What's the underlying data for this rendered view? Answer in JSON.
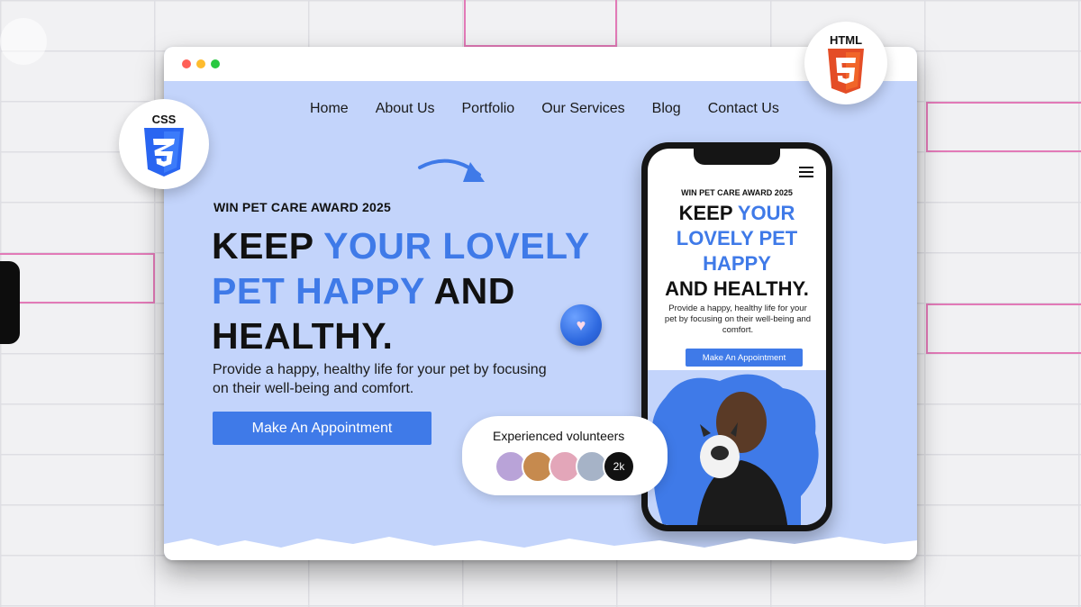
{
  "nav": [
    "Home",
    "About Us",
    "Portfolio",
    "Our Services",
    "Blog",
    "Contact Us"
  ],
  "hero": {
    "award": "WIN PET CARE AWARD 2025",
    "headline_1": "KEEP ",
    "headline_blue": "YOUR LOVELY PET HAPPY",
    "headline_2": " AND HEALTHY.",
    "subtext": "Provide a happy, healthy life for your pet by focusing on their well-being and comfort.",
    "cta": "Make An Appointment"
  },
  "volunteers": {
    "title": "Experienced volunteers",
    "count": "2k"
  },
  "phone": {
    "award": "WIN PET CARE AWARD 2025",
    "headline_1": "KEEP ",
    "headline_blue": "YOUR LOVELY PET HAPPY",
    "headline_2": "AND HEALTHY.",
    "subtext": "Provide a happy, healthy life for your pet by focusing on their well-being and comfort.",
    "cta": "Make An Appointment"
  },
  "badges": {
    "css": "CSS",
    "html": "HTML"
  },
  "colors": {
    "accent": "#3f7ae8",
    "hero_bg": "#c3d4fb",
    "css_shield": "#2965f1",
    "html_shield": "#e44d26"
  }
}
